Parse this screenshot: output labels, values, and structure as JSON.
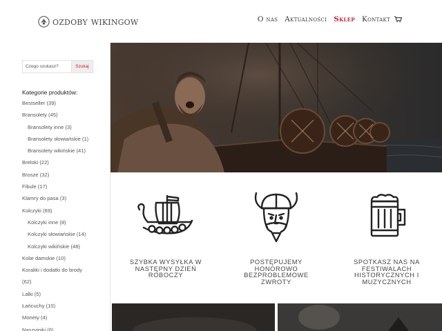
{
  "header": {
    "logo_text": "ozdoby wikingow",
    "nav": [
      {
        "label": "O nas"
      },
      {
        "label": "Aktualności"
      },
      {
        "label": "Sklep",
        "active": true
      },
      {
        "label": "Kontakt"
      }
    ],
    "cart_icon": "cart-icon"
  },
  "sidebar": {
    "search": {
      "placeholder": "Czego szukasz?",
      "button_label": "Szukaj"
    },
    "categories_title": "Kategorie produktów:",
    "categories": [
      {
        "label": "Bestseller (39)",
        "sub": false
      },
      {
        "label": "Bransolety (45)",
        "sub": false
      },
      {
        "label": "Bransolety inne (3)",
        "sub": true
      },
      {
        "label": "Bransolety słowiańskie (1)",
        "sub": true
      },
      {
        "label": "Bransolety wikińskie (41)",
        "sub": true
      },
      {
        "label": "Breloki (22)",
        "sub": false
      },
      {
        "label": "Brosze (32)",
        "sub": false
      },
      {
        "label": "Fibule (17)",
        "sub": false
      },
      {
        "label": "Klamry do pasa (3)",
        "sub": false
      },
      {
        "label": "Kolczyki (69)",
        "sub": false
      },
      {
        "label": "Kolczyki inne (8)",
        "sub": true
      },
      {
        "label": "Kolczyki słowiańskie (14)",
        "sub": true
      },
      {
        "label": "Kolczyki wikińskie (48)",
        "sub": true
      },
      {
        "label": "Kolie damskie (10)",
        "sub": false
      },
      {
        "label": "Koraliki i dodatki do brody",
        "sub": false
      },
      {
        "label": "(62)",
        "sub": false
      },
      {
        "label": "Lalki (5)",
        "sub": false
      },
      {
        "label": "Łańcuchy (10)",
        "sub": false
      },
      {
        "label": "Monety (4)",
        "sub": false
      },
      {
        "label": "Naszyjniki (6)",
        "sub": false
      }
    ]
  },
  "features": [
    {
      "icon": "viking-ship-icon",
      "text": "Szybka wysyłka w następny dzień roboczy"
    },
    {
      "icon": "viking-head-icon",
      "text": "Postępujemy honorowo bezproblemowe zwroty"
    },
    {
      "icon": "beer-tankard-icon",
      "text": "Spotkasz nas na festiwalach historycznych i muzycznych"
    }
  ],
  "colors": {
    "accent": "#c2203a",
    "text": "#333333",
    "hero_dark": "#3c2f28"
  }
}
